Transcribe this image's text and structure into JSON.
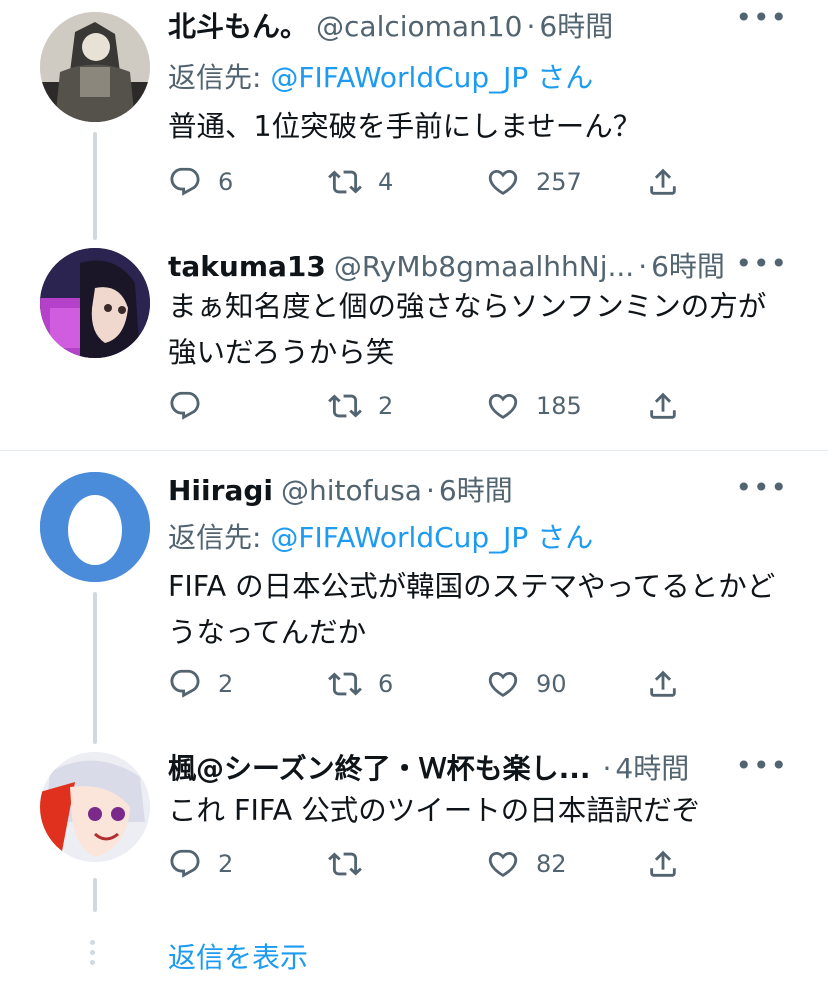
{
  "tweets": [
    {
      "name": "北斗もん。",
      "handle": "@calcioman10",
      "dot": "·",
      "time": "6時間",
      "more": "•••",
      "reply_prefix": "返信先: ",
      "reply_mention": "@FIFAWorldCup_JP",
      "reply_suffix": " さん",
      "text": "普通、1位突破を手前にしませーん？",
      "replies": "6",
      "retweets": "4",
      "likes": "257"
    },
    {
      "name": "takuma13",
      "handle": "@RyMb8gmaalhhNj...",
      "dot": "·",
      "time": "6時間",
      "more": "•••",
      "text": "まぁ知名度と個の強さならソンフンミンの方が強いだろうから笑",
      "replies": "",
      "retweets": "2",
      "likes": "185"
    },
    {
      "name": "Hiiragi",
      "handle": "@hitofusa",
      "dot": "·",
      "time": "6時間",
      "more": "•••",
      "reply_prefix": "返信先: ",
      "reply_mention": "@FIFAWorldCup_JP",
      "reply_suffix": " さん",
      "text": "FIFA の日本公式が韓国のステマやってるとかどうなってんだか",
      "replies": "2",
      "retweets": "6",
      "likes": "90"
    },
    {
      "name": "楓@シーズン終了・Ｗ杯も楽し...",
      "handle": "",
      "dot": "·",
      "time": "4時間",
      "more": "•••",
      "text": "これ FIFA 公式のツイートの日本語訳だぞ",
      "replies": "2",
      "retweets": "",
      "likes": "82"
    }
  ],
  "show_replies": "返信を表示",
  "icons": {
    "reply": "reply-icon",
    "retweet": "retweet-icon",
    "like": "heart-icon",
    "share": "share-icon"
  },
  "colors": {
    "link": "#1d9bf0",
    "secondary": "#536471",
    "avatar_egg_bg": "#4a8cd9"
  }
}
